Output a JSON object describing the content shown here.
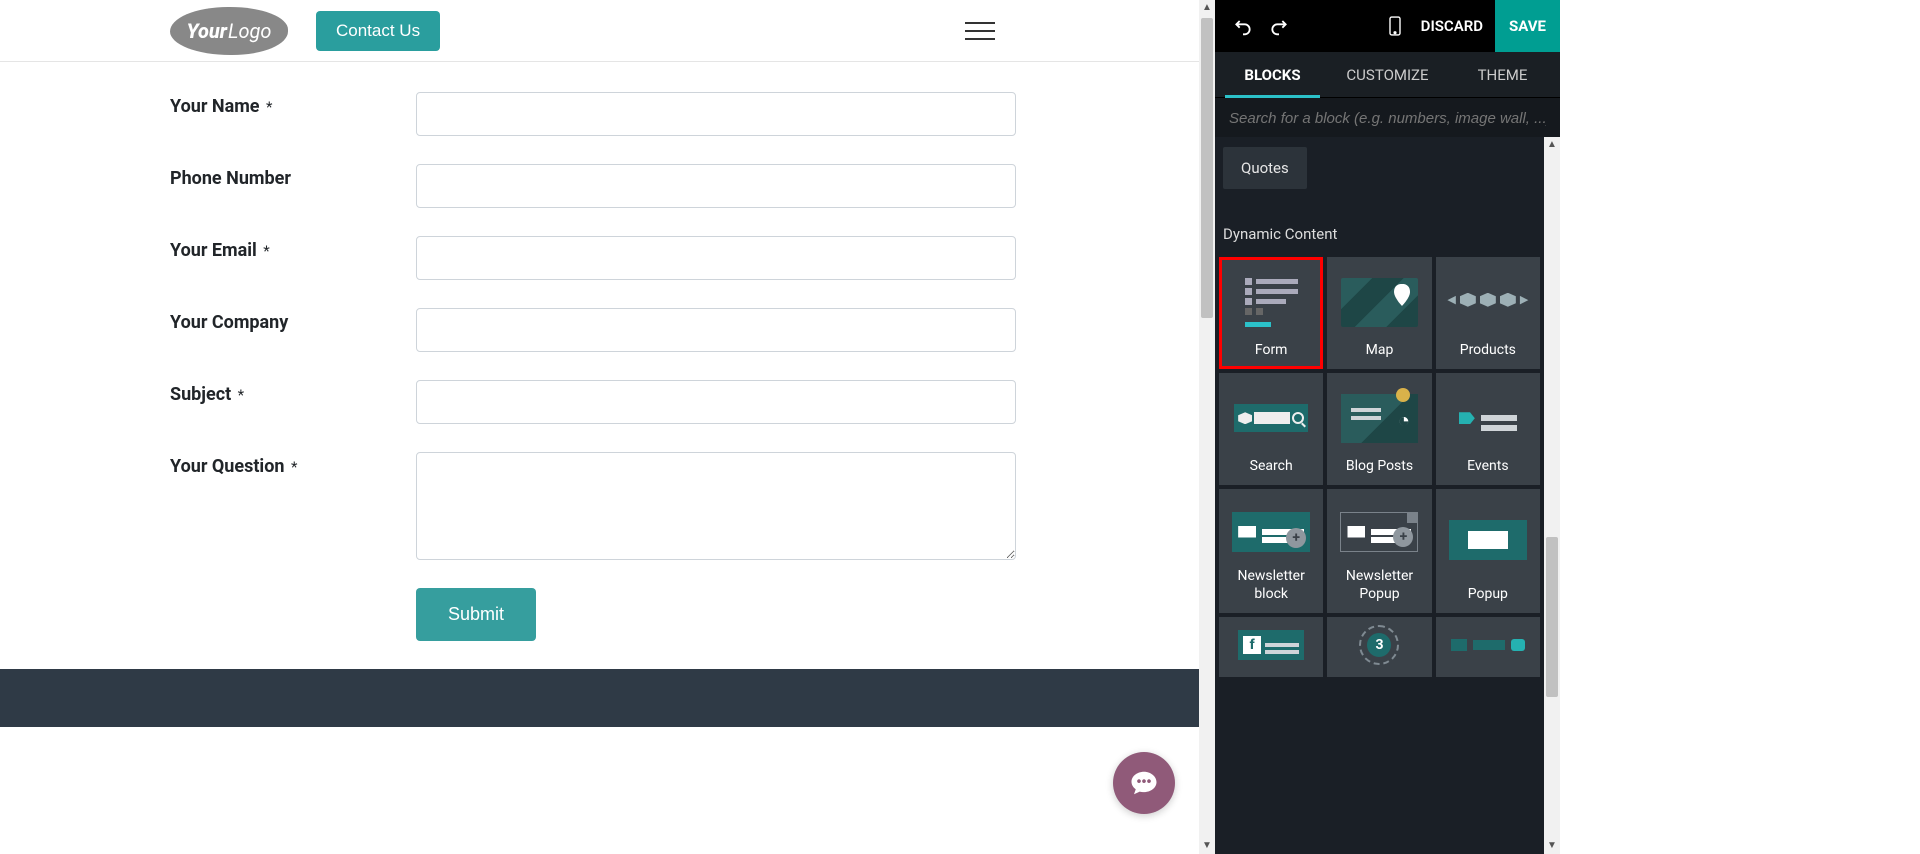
{
  "site": {
    "logo": {
      "part1": "Your",
      "part2": "Logo"
    },
    "contact_button": "Contact Us"
  },
  "form": {
    "fields": [
      {
        "label": "Your Name",
        "required": true,
        "type": "text"
      },
      {
        "label": "Phone Number",
        "required": false,
        "type": "text"
      },
      {
        "label": "Your Email",
        "required": true,
        "type": "text"
      },
      {
        "label": "Your Company",
        "required": false,
        "type": "text"
      },
      {
        "label": "Subject",
        "required": true,
        "type": "text"
      },
      {
        "label": "Your Question",
        "required": true,
        "type": "textarea"
      }
    ],
    "submit_label": "Submit",
    "required_marker": "*"
  },
  "editor": {
    "toolbar": {
      "discard": "DISCARD",
      "save": "SAVE"
    },
    "tabs": [
      {
        "label": "BLOCKS",
        "active": true
      },
      {
        "label": "CUSTOMIZE",
        "active": false
      },
      {
        "label": "THEME",
        "active": false
      }
    ],
    "search_placeholder": "Search for a block (e.g. numbers, image wall, ...)",
    "quotes_label": "Quotes",
    "section_title": "Dynamic Content",
    "blocks": [
      {
        "id": "form",
        "label": "Form",
        "highlighted": true
      },
      {
        "id": "map",
        "label": "Map",
        "highlighted": false
      },
      {
        "id": "products",
        "label": "Products",
        "highlighted": false
      },
      {
        "id": "search",
        "label": "Search",
        "highlighted": false
      },
      {
        "id": "blogposts",
        "label": "Blog Posts",
        "highlighted": false
      },
      {
        "id": "events",
        "label": "Events",
        "highlighted": false
      },
      {
        "id": "newsletterblock",
        "label": "Newsletter block",
        "highlighted": false
      },
      {
        "id": "newsletterpopup",
        "label": "Newsletter Popup",
        "highlighted": false
      },
      {
        "id": "popup",
        "label": "Popup",
        "highlighted": false
      },
      {
        "id": "facebook",
        "label": "",
        "highlighted": false
      },
      {
        "id": "countdown",
        "label": "",
        "highlighted": false
      },
      {
        "id": "donation",
        "label": "",
        "highlighted": false
      }
    ],
    "countdown_digit": "3"
  }
}
